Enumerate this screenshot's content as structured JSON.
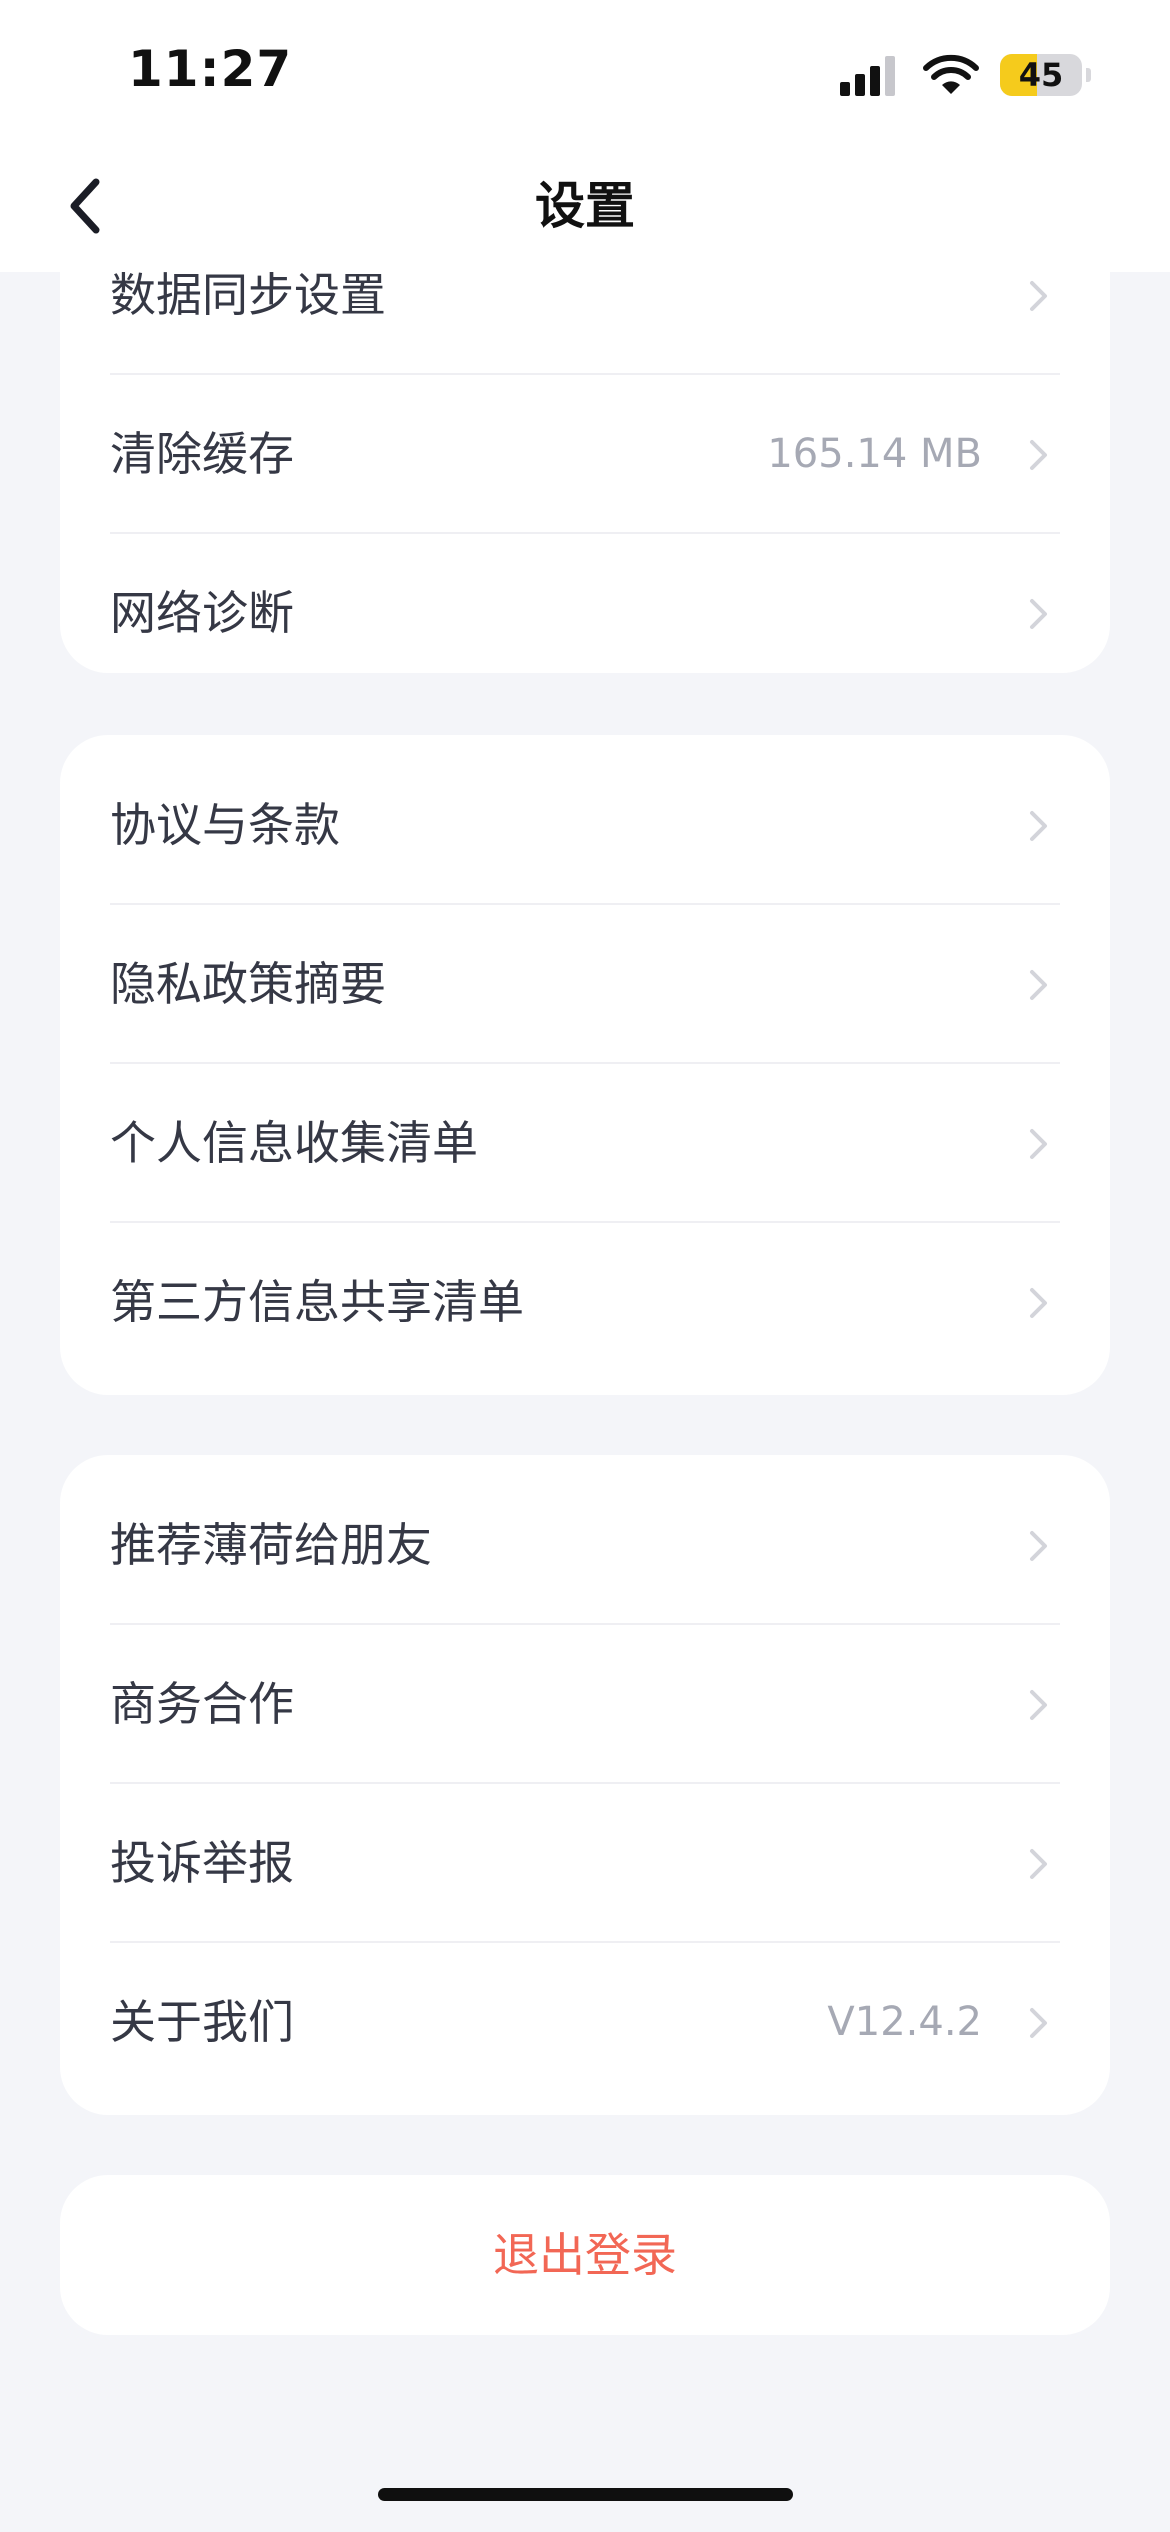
{
  "status_bar": {
    "time": "11:27",
    "battery_level": "45",
    "battery_fraction": 0.45,
    "icons": [
      "signal-icon",
      "wifi-icon",
      "battery-icon"
    ]
  },
  "nav": {
    "title": "设置",
    "back_icon": "chevron-left-icon"
  },
  "groups": [
    {
      "items": [
        {
          "label": "数据同步设置",
          "value": ""
        },
        {
          "label": "清除缓存",
          "value": "165.14 MB"
        },
        {
          "label": "网络诊断",
          "value": ""
        }
      ]
    },
    {
      "items": [
        {
          "label": "协议与条款",
          "value": ""
        },
        {
          "label": "隐私政策摘要",
          "value": ""
        },
        {
          "label": "个人信息收集清单",
          "value": ""
        },
        {
          "label": "第三方信息共享清单",
          "value": ""
        }
      ]
    },
    {
      "items": [
        {
          "label": "推荐薄荷给朋友",
          "value": ""
        },
        {
          "label": "商务合作",
          "value": ""
        },
        {
          "label": "投诉举报",
          "value": ""
        },
        {
          "label": "关于我们",
          "value": "V12.4.2"
        }
      ]
    }
  ],
  "logout": {
    "label": "退出登录"
  },
  "colors": {
    "background": "#f4f5f9",
    "card": "#ffffff",
    "label": "#353845",
    "value": "#a6a9b4",
    "logout": "#f26755",
    "battery_fill": "#f5cb1c"
  }
}
